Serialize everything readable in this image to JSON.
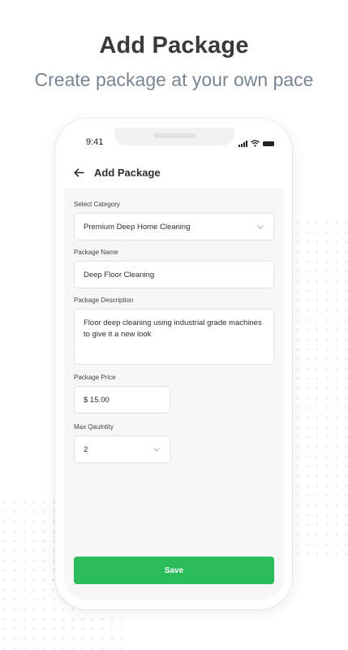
{
  "hero": {
    "title": "Add Package",
    "subtitle": "Create package at your own pace"
  },
  "status_bar": {
    "time": "9:41",
    "icons": [
      "signal-icon",
      "wifi-icon",
      "battery-icon"
    ]
  },
  "nav": {
    "back_icon": "arrow-left-icon",
    "title": "Add Package"
  },
  "form": {
    "category": {
      "label": "Select Category",
      "value": "Premium Deep Home Cleaning"
    },
    "name": {
      "label": "Package Name",
      "value": "Deep Floor Cleaning"
    },
    "description": {
      "label": "Package Description",
      "value": "Floor deep cleaning using industrial grade machines to give it a new look"
    },
    "price": {
      "label": "Package Price",
      "value": "$ 15.00"
    },
    "quantity": {
      "label": "Max Qaulntity",
      "value": "2"
    }
  },
  "actions": {
    "save_label": "Save"
  },
  "colors": {
    "accent": "#2bbd5c",
    "heading": "#3a3a3a",
    "subtitle": "#7a8592"
  }
}
